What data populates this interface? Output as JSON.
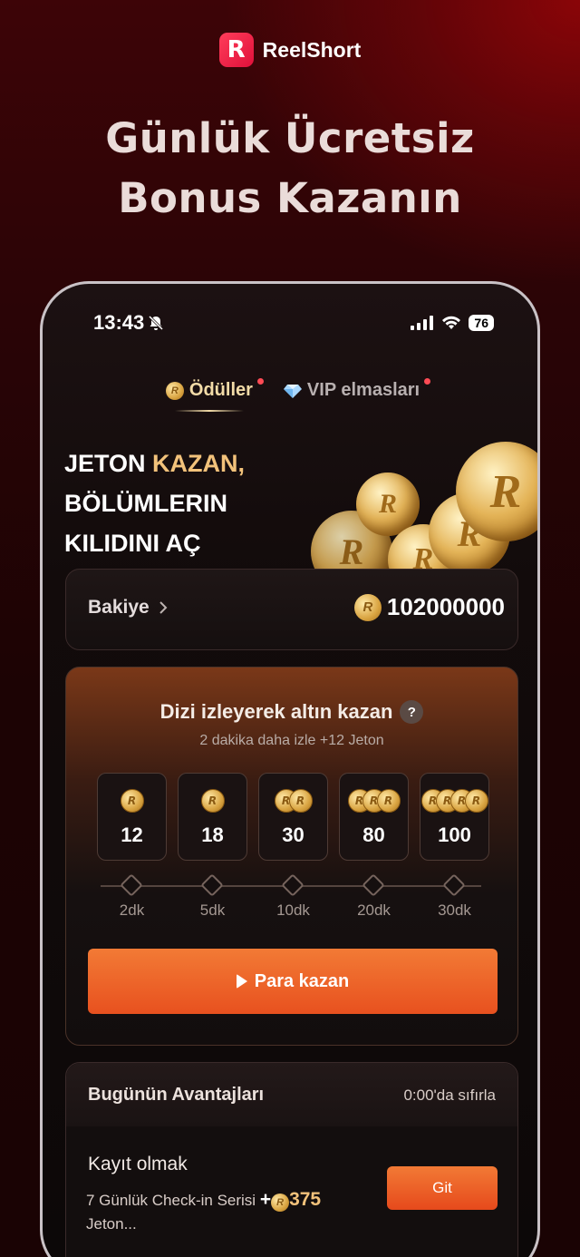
{
  "brand": {
    "logo_letter": "R",
    "name": "ReelShort"
  },
  "headline": {
    "line1": "Günlük Ücretsiz",
    "line2": "Bonus Kazanın"
  },
  "status_bar": {
    "time": "13:43",
    "battery": "76"
  },
  "tabs": [
    {
      "label": "Ödüller",
      "active": true,
      "icon": "coin-icon"
    },
    {
      "label": "VIP elmasları",
      "active": false,
      "icon": "diamond-icon"
    }
  ],
  "promo": {
    "line1_white": "JETON ",
    "line1_gold": "KAZAN,",
    "line2": "BÖLÜMLERIN",
    "line3": "KILIDINI AÇ"
  },
  "balance": {
    "label": "Bakiye",
    "value": "102000000"
  },
  "earn": {
    "title": "Dizi izleyerek altın kazan",
    "subtitle": "2 dakika daha izle +12 Jeton",
    "rewards": [
      {
        "amount": "12",
        "time": "2dk",
        "coins": 1
      },
      {
        "amount": "18",
        "time": "5dk",
        "coins": 1
      },
      {
        "amount": "30",
        "time": "10dk",
        "coins": 2
      },
      {
        "amount": "80",
        "time": "20dk",
        "coins": 3
      },
      {
        "amount": "100",
        "time": "30dk",
        "coins": 4
      }
    ],
    "button_label": "Para kazan"
  },
  "perks": {
    "title": "Bugünün Avantajları",
    "reset": "0:00'da sıfırla",
    "task_title": "Kayıt olmak",
    "task_desc": "7 Günlük Check-in Serisi",
    "task_plus": "+",
    "task_bonus": "375",
    "task_desc_tail": "Jeton...",
    "go_label": "Git"
  },
  "colors": {
    "accent": "#e8511f",
    "gold": "#f2c27b"
  }
}
